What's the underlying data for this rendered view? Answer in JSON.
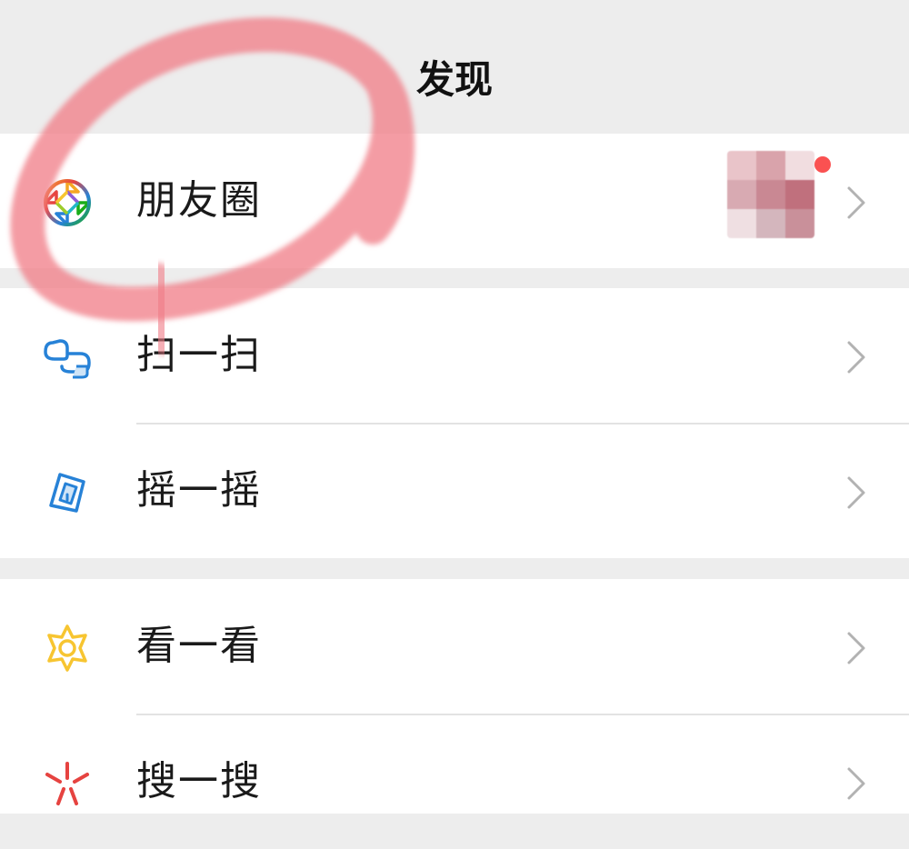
{
  "header": {
    "title": "发现"
  },
  "menu": {
    "items": [
      {
        "id": "moments",
        "label": "朋友圈",
        "icon": "moments-aperture-icon"
      },
      {
        "id": "scan",
        "label": "扫一扫",
        "icon": "scan-icon"
      },
      {
        "id": "shake",
        "label": "摇一摇",
        "icon": "shake-icon"
      },
      {
        "id": "top-stories",
        "label": "看一看",
        "icon": "top-stories-icon"
      },
      {
        "id": "search",
        "label": "搜一搜",
        "icon": "search-sparkle-icon"
      }
    ]
  },
  "moments_preview": {
    "thumbnail_colors": [
      "#e9c4c9",
      "#d9a3ab",
      "#f1dde0",
      "#d8aab2",
      "#c98893",
      "#c0707d",
      "#efdfe2",
      "#d4b6bd",
      "#c9909a"
    ],
    "unread_dot_color": "#fa5151"
  },
  "colors": {
    "background": "#ededed",
    "row_background": "#ffffff",
    "annotation": "#f07b86",
    "chevron": "#b2b2b2"
  }
}
